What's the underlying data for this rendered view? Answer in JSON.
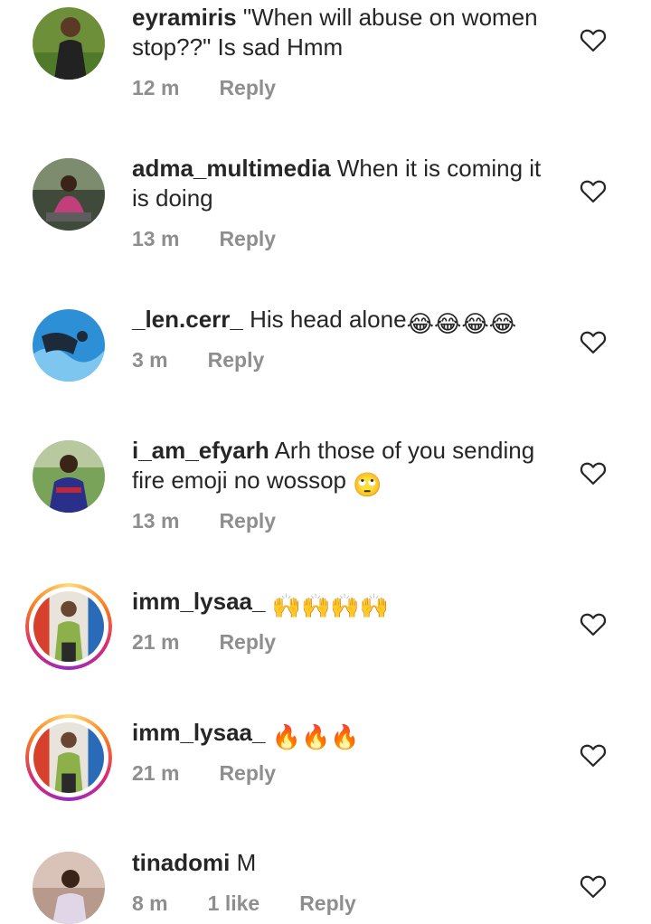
{
  "comments": [
    {
      "username": "eyramiris",
      "text": "\"When will abuse on women stop??\" Is sad  Hmm",
      "time": "12 m",
      "reply": "Reply"
    },
    {
      "username": "adma_multimedia",
      "text": "When it is coming it is doing",
      "time": "13 m",
      "reply": "Reply"
    },
    {
      "username": "_len.cerr_",
      "text": "His head alone",
      "emoji": "😂😂😂😂",
      "time": "3 m",
      "reply": "Reply"
    },
    {
      "username": "i_am_efyarh",
      "text": "Arh those of you sending fire emoji no wossop",
      "emoji": "🙄",
      "time": "13 m",
      "reply": "Reply"
    },
    {
      "username": "imm_lysaa_",
      "text": "",
      "emoji": "🙌🙌🙌🙌",
      "time": "21 m",
      "reply": "Reply"
    },
    {
      "username": "imm_lysaa_",
      "text": "",
      "emoji": "🔥🔥🔥",
      "time": "21 m",
      "reply": "Reply"
    },
    {
      "username": "tinadomi",
      "text": "M",
      "time": "8 m",
      "likes": "1 like",
      "reply": "Reply"
    }
  ],
  "colors": {
    "text": "#262626",
    "muted": "#8e8e8e",
    "heart_outline": "#262626"
  },
  "icons": {
    "like": "heart-outline-icon"
  }
}
